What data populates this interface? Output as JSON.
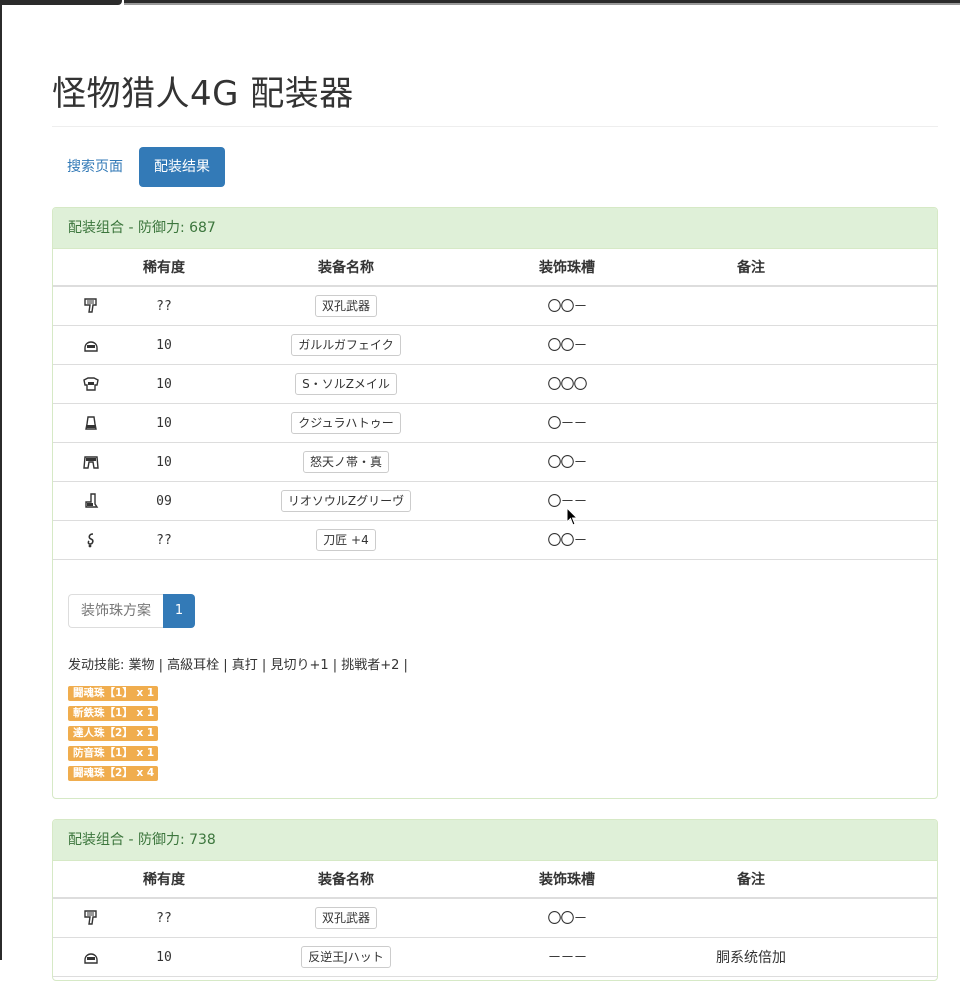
{
  "page": {
    "title": "怪物猎人4G 配装器"
  },
  "nav": {
    "search_label": "搜索页面",
    "result_label": "配装结果"
  },
  "table_headers": {
    "rarity": "稀有度",
    "name": "装备名称",
    "slots": "装饰珠槽",
    "note": "备注"
  },
  "results": [
    {
      "heading": "配装组合 - 防御力: 687",
      "rows": [
        {
          "icon": "weapon-icon",
          "rarity": "??",
          "name": "双孔武器",
          "slots": "〇〇－",
          "note": ""
        },
        {
          "icon": "helmet-icon",
          "rarity": "10",
          "name": "ガルルガフェイク",
          "slots": "〇〇－",
          "note": ""
        },
        {
          "icon": "chest-icon",
          "rarity": "10",
          "name": "S・ソルZメイル",
          "slots": "〇〇〇",
          "note": ""
        },
        {
          "icon": "arms-icon",
          "rarity": "10",
          "name": "クジュラハトゥー",
          "slots": "〇－－",
          "note": ""
        },
        {
          "icon": "waist-icon",
          "rarity": "10",
          "name": "怒天ノ帯・真",
          "slots": "〇〇－",
          "note": ""
        },
        {
          "icon": "legs-icon",
          "rarity": "09",
          "name": "リオソウルZグリーヴ",
          "slots": "〇－－",
          "note": ""
        },
        {
          "icon": "talisman-icon",
          "rarity": "??",
          "name": "刀匠 +4",
          "slots": "〇〇－",
          "note": ""
        }
      ],
      "pager": {
        "label": "装饰珠方案",
        "current": "1"
      },
      "skills": "发动技能: 業物 | 高級耳栓 | 真打 | 見切り+1 | 挑戦者+2 |",
      "jewels": [
        "闘魂珠【1】 x 1",
        "斬鉄珠【1】 x 1",
        "達人珠【2】 x 1",
        "防音珠【1】 x 1",
        "闘魂珠【2】 x 4"
      ]
    },
    {
      "heading": "配装组合 - 防御力: 738",
      "rows": [
        {
          "icon": "weapon-icon",
          "rarity": "??",
          "name": "双孔武器",
          "slots": "〇〇－",
          "note": ""
        },
        {
          "icon": "helmet-icon",
          "rarity": "10",
          "name": "反逆王Jハット",
          "slots": "－－－",
          "note": "胴系统倍加"
        }
      ]
    }
  ],
  "colors": {
    "primary": "#337ab7",
    "success_bg": "#dff0d8",
    "success_text": "#3c763d",
    "warning": "#f0ad4e"
  }
}
